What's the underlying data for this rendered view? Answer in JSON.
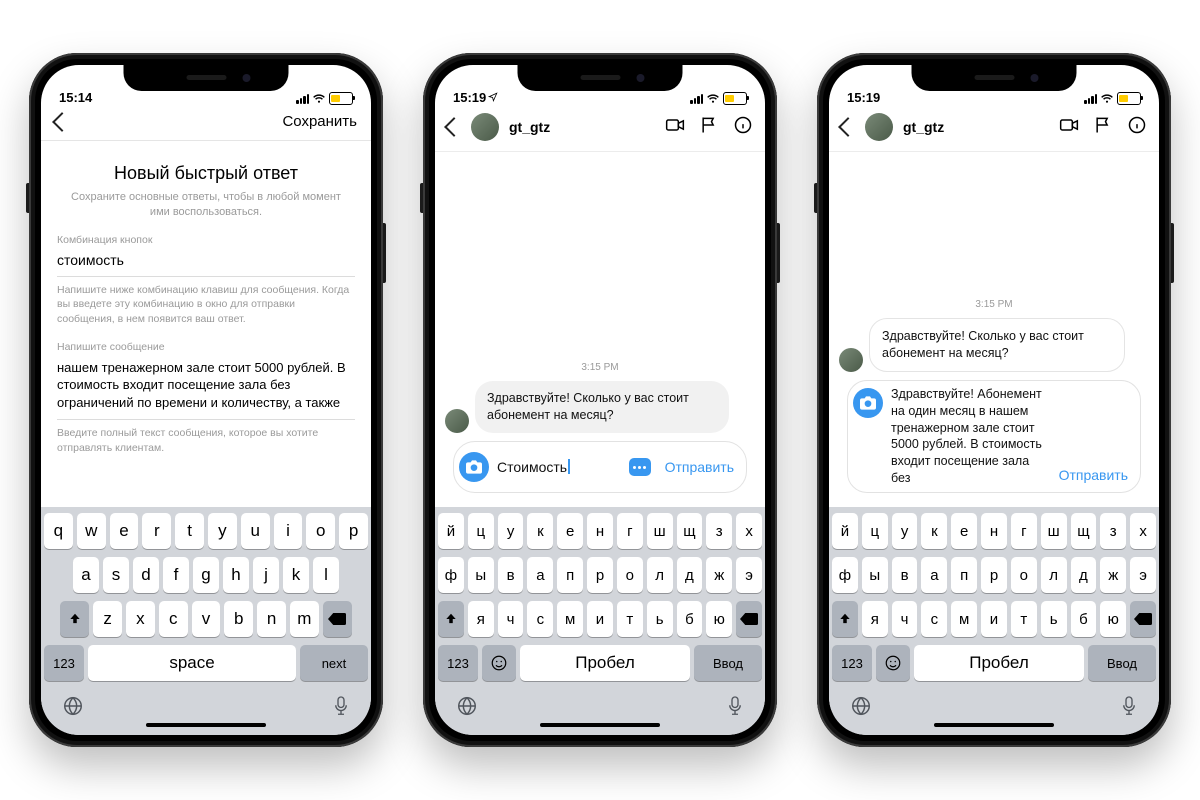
{
  "status": {
    "t1": "15:14",
    "t2": "15:19",
    "t3": "15:19"
  },
  "p1": {
    "save": "Сохранить",
    "title": "Новый быстрый ответ",
    "subtitle": "Сохраните основные ответы, чтобы в любой момент ими воспользоваться.",
    "shortcut_label": "Комбинация кнопок",
    "shortcut_value": "стоимость",
    "shortcut_hint": "Напишите ниже комбинацию клавиш для сообщения. Когда вы введете эту комбинацию в окно для отправки сообщения, в нем появится ваш ответ.",
    "message_label": "Напишите сообщение",
    "message_value": "нашем тренажерном зале стоит 5000 рублей. В стоимость входит посещение зала без ограничений по времени и количеству, а также",
    "message_hint": "Введите полный текст сообщения, которое вы хотите отправлять клиентам."
  },
  "chat": {
    "username": "gt_gtz",
    "timestamp": "3:15 PM",
    "incoming": "Здравствуйте! Сколько у вас стоит абонемент на месяц?",
    "input_p2": "Стоимость",
    "input_p3": "Здравствуйте! Абонемент на один месяц в нашем тренажерном зале стоит 5000 рублей. В стоимость входит посещение зала без",
    "send": "Отправить"
  },
  "kbd_en": {
    "r1": [
      "q",
      "w",
      "e",
      "r",
      "t",
      "y",
      "u",
      "i",
      "o",
      "p"
    ],
    "r2": [
      "a",
      "s",
      "d",
      "f",
      "g",
      "h",
      "j",
      "k",
      "l"
    ],
    "r3": [
      "z",
      "x",
      "c",
      "v",
      "b",
      "n",
      "m"
    ],
    "num": "123",
    "space": "space",
    "next": "next"
  },
  "kbd_ru": {
    "r1": [
      "й",
      "ц",
      "у",
      "к",
      "е",
      "н",
      "г",
      "ш",
      "щ",
      "з",
      "х"
    ],
    "r2": [
      "ф",
      "ы",
      "в",
      "а",
      "п",
      "р",
      "о",
      "л",
      "д",
      "ж",
      "э"
    ],
    "r3": [
      "я",
      "ч",
      "с",
      "м",
      "и",
      "т",
      "ь",
      "б",
      "ю"
    ],
    "num": "123",
    "space": "Пробел",
    "next": "Ввод"
  }
}
